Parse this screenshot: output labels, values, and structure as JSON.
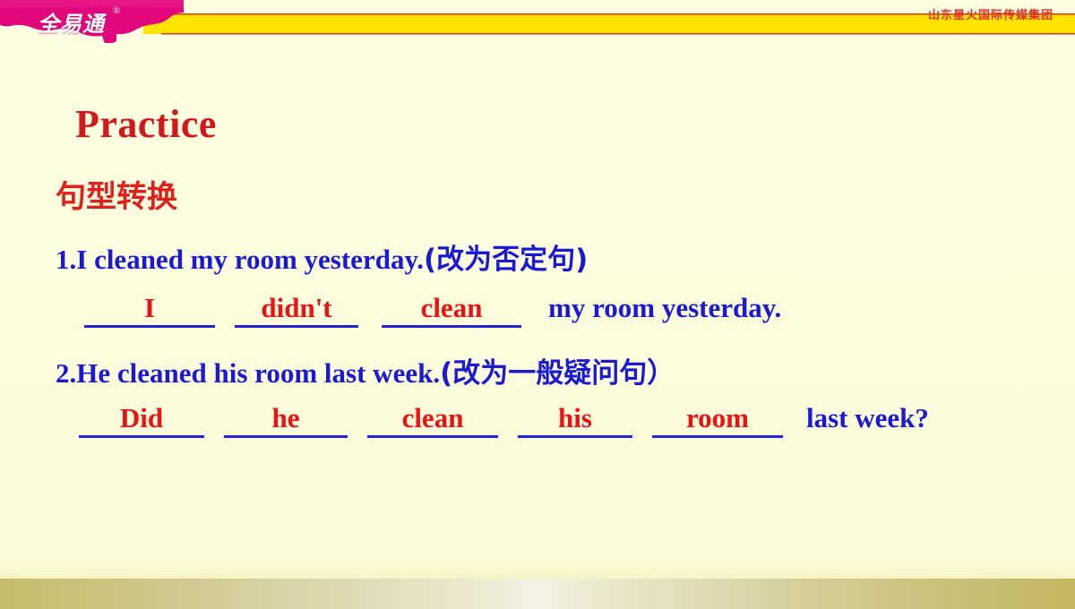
{
  "banner": {
    "logo_text": "全易通",
    "logo_mark": "®",
    "org_text": "山东星火国际传媒集团",
    "magenta_color": "#e3077e",
    "yellow_color": "#ffe400",
    "org_text_color": "#d9342b"
  },
  "slide": {
    "title": "Practice",
    "title_color": "#d2181c",
    "subtitle": "句型转换",
    "subtitle_color": "#e0201c",
    "background_color": "#fdfde2",
    "question_color": "#1a1ad6",
    "answer_color": "#ee1111",
    "underline_color": "#2222e0"
  },
  "questions": [
    {
      "number": "1.",
      "english": "I cleaned my room yesterday.",
      "instruction": "(改为否定句)",
      "answer_blanks": [
        "I",
        "didn't",
        "clean"
      ],
      "trailing_text": "my room yesterday."
    },
    {
      "number": "2.",
      "english": "He cleaned his room last week.",
      "instruction": "(改为一般疑问句）",
      "answer_blanks": [
        "Did",
        "he",
        "clean",
        "his",
        "room"
      ],
      "trailing_text": "last week?"
    }
  ]
}
